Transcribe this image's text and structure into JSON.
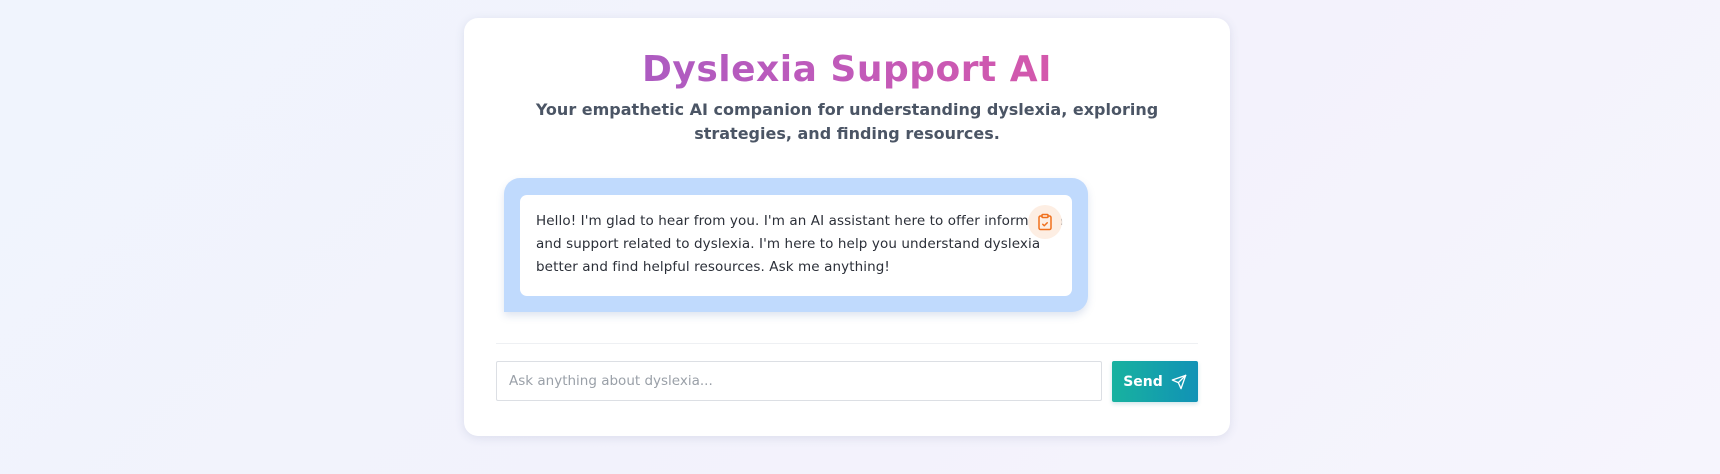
{
  "header": {
    "title": "Dyslexia Support AI",
    "subtitle": "Your empathetic AI companion for understanding dyslexia, exploring strategies, and finding resources."
  },
  "chat": {
    "messages": [
      {
        "role": "assistant",
        "text": "Hello! I'm glad to hear from you. I'm an AI assistant here to offer information and support related to dyslexia. I'm here to help you understand dyslexia better and find helpful resources. Ask me anything!",
        "copy_icon": "clipboard-icon"
      }
    ]
  },
  "composer": {
    "placeholder": "Ask anything about dyslexia...",
    "value": "",
    "send_label": "Send",
    "send_icon": "paper-plane-icon"
  },
  "colors": {
    "title_gradient": [
      "#9b5cc7",
      "#e4569f"
    ],
    "chat_bubble_bg": "#c0dafd",
    "copy_icon_color": "#f0701d",
    "send_gradient": [
      "#18b29f",
      "#1192b6"
    ]
  }
}
